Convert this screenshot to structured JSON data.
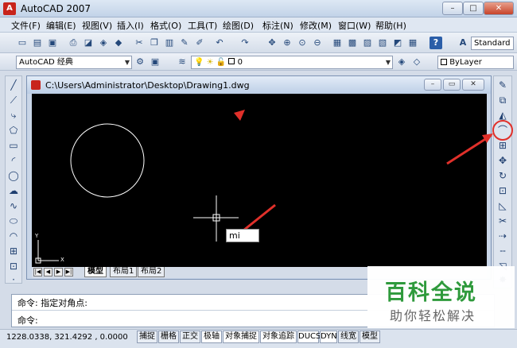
{
  "window": {
    "title": "AutoCAD 2007",
    "icon_letter": "A",
    "minimize": "–",
    "maximize": "□",
    "close": "✕"
  },
  "menubar": {
    "items": [
      "文件(F)",
      "编辑(E)",
      "视图(V)",
      "插入(I)",
      "格式(O)",
      "工具(T)",
      "绘图(D)",
      "标注(N)",
      "修改(M)",
      "窗口(W)",
      "帮助(H)"
    ]
  },
  "toolbar1": {
    "text_style_combo": "Standard"
  },
  "toolbar2": {
    "workspace_combo": "AutoCAD 经典",
    "layer_combo": "0",
    "color_combo": "ByLayer"
  },
  "drawing": {
    "path": "C:\\Users\\Administrator\\Desktop\\Drawing1.dwg",
    "command_input": "mi",
    "ucs_y": "Y",
    "ucs_x": "X",
    "tabs": [
      "模型",
      "布局1",
      "布局2"
    ]
  },
  "command": {
    "line1": "命令: 指定对角点:",
    "line2": "命令:"
  },
  "statusbar": {
    "coordinates": "1228.0338, 321.4292 , 0.0000",
    "toggles": [
      "捕捉",
      "栅格",
      "正交",
      "极轴",
      "对象捕捉",
      "对象追踪",
      "DUCS",
      "DYN",
      "线宽",
      "模型"
    ]
  },
  "watermark": {
    "title": "百科全说",
    "subtitle": "助你轻松解决"
  },
  "colors": {
    "annotation_red": "#e0302a",
    "watermark_green": "#2f9a3c"
  }
}
